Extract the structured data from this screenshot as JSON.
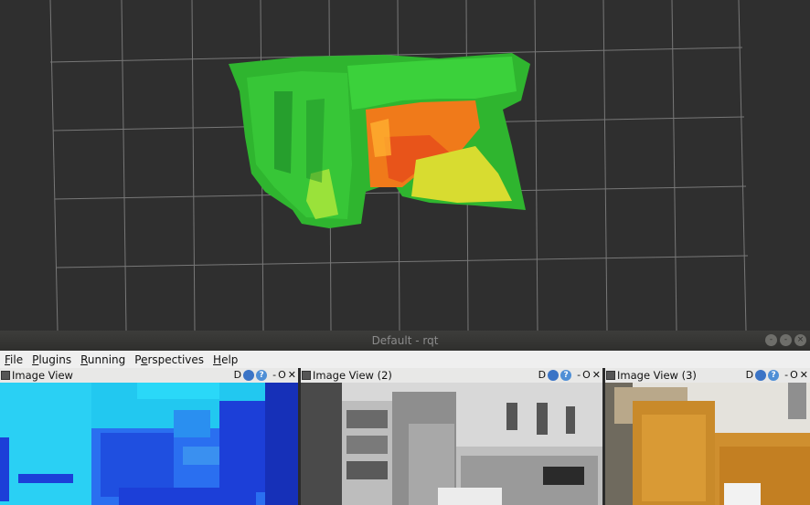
{
  "window": {
    "title": "Default - rqt",
    "buttons": [
      "-",
      "-",
      "×"
    ]
  },
  "menu": [
    {
      "label": "File",
      "u": "F",
      "rest": "ile"
    },
    {
      "label": "Plugins",
      "u": "P",
      "rest": "lugins"
    },
    {
      "label": "Running",
      "u": "R",
      "rest": "unning"
    },
    {
      "label": "Perspectives",
      "pre": "P",
      "u": "e",
      "rest": "rspectives"
    },
    {
      "label": "Help",
      "u": "H",
      "rest": "elp"
    }
  ],
  "panels": [
    {
      "title": "Image View",
      "d_label": "D",
      "help_label": "?",
      "min_label": "-",
      "o_label": "O",
      "close_label": "✕"
    },
    {
      "title": "Image View (2)",
      "d_label": "D",
      "help_label": "?",
      "min_label": "-",
      "o_label": "O",
      "close_label": "✕"
    },
    {
      "title": "Image View (3)",
      "d_label": "D",
      "help_label": "?",
      "min_label": "-",
      "o_label": "O",
      "close_label": "✕"
    }
  ],
  "colors": {
    "viz_background": "#2f2f2f",
    "grid_line": "#9a9a9a",
    "point_cloud_green": "#33cc33",
    "point_cloud_orange": "#e8641a",
    "point_cloud_yellow": "#d6e030",
    "depth_cyan": "#22c8f0",
    "depth_blue": "#1c3fd8"
  },
  "icons": {
    "dock": "grip-icon",
    "refresh": "refresh-icon",
    "help": "help-icon",
    "close": "close-icon"
  }
}
